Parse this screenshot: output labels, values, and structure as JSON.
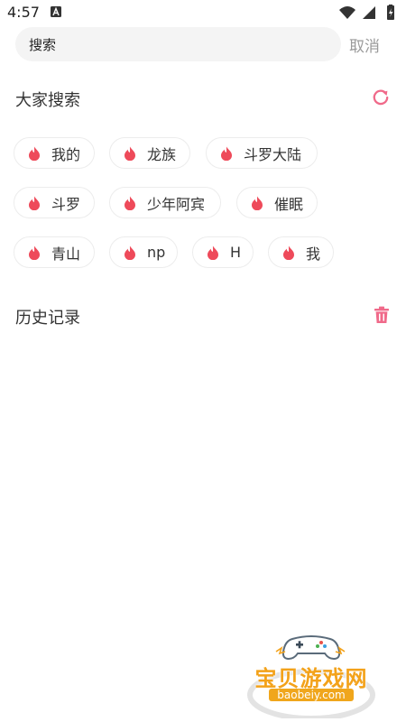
{
  "status_bar": {
    "time": "4:57"
  },
  "search": {
    "value": "搜索",
    "cancel_label": "取消"
  },
  "hot": {
    "title": "大家搜索",
    "rows": [
      [
        "我的",
        "龙族",
        "斗罗大陆"
      ],
      [
        "斗罗",
        "少年阿宾",
        "催眠"
      ],
      [
        "青山",
        "np",
        "H",
        "我"
      ]
    ]
  },
  "history": {
    "title": "历史记录"
  },
  "watermark": {
    "name": "宝贝游戏网",
    "domain": "baobeiy.com"
  },
  "colors": {
    "accent": "#f06a8a",
    "flame": "#ee4a5a",
    "chip_border": "#ececec",
    "search_bg": "#f4f4f4",
    "watermark": "#f3a21a"
  },
  "icons": {
    "refresh": "refresh-icon",
    "trash": "trash-icon",
    "flame": "flame-icon"
  }
}
